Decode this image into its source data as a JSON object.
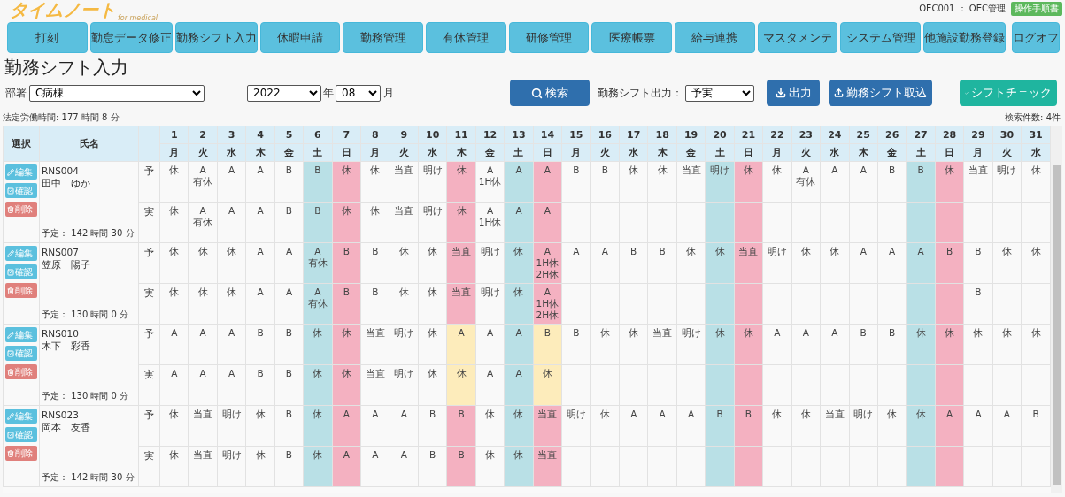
{
  "header": {
    "logo": "タイムノート",
    "logo_sub": "for medical",
    "user": "OEC001 ： OEC管理",
    "manual_button": "操作手順書"
  },
  "nav": [
    {
      "label": "打刻"
    },
    {
      "label": "勤怠データ修正"
    },
    {
      "label": "勤務シフト入力"
    },
    {
      "label": "休暇申請"
    },
    {
      "label": "勤務管理"
    },
    {
      "label": "有休管理"
    },
    {
      "label": "研修管理"
    },
    {
      "label": "医療帳票"
    },
    {
      "label": "給与連携"
    },
    {
      "label": "マスタメンテ"
    },
    {
      "label": "システム管理"
    },
    {
      "label": "他施設勤務登録"
    }
  ],
  "logoff": "ログオフ",
  "page_title": "勤務シフト入力",
  "filters": {
    "department_label": "部署",
    "department": "C病棟",
    "year": "2022",
    "year_unit": "年",
    "month": "08",
    "month_unit": "月",
    "search_button": "検索",
    "output_label": "勤務シフト出力：",
    "output_value": "予実",
    "export_button": "出力",
    "import_button": "勤務シフト取込",
    "check_button": "シフトチェック"
  },
  "legal_hours": "法定労働時間: 177 時間 8 分",
  "result_count": "検索件数: 4件",
  "table": {
    "columns": [
      "選択",
      "氏名"
    ],
    "days": [
      {
        "day": "1",
        "weekday": "月",
        "kind": "weekday"
      },
      {
        "day": "2",
        "weekday": "火",
        "kind": "weekday"
      },
      {
        "day": "3",
        "weekday": "水",
        "kind": "weekday"
      },
      {
        "day": "4",
        "weekday": "木",
        "kind": "weekday"
      },
      {
        "day": "5",
        "weekday": "金",
        "kind": "weekday"
      },
      {
        "day": "6",
        "weekday": "土",
        "kind": "saturday"
      },
      {
        "day": "7",
        "weekday": "日",
        "kind": "holiday"
      },
      {
        "day": "8",
        "weekday": "月",
        "kind": "weekday"
      },
      {
        "day": "9",
        "weekday": "火",
        "kind": "weekday"
      },
      {
        "day": "10",
        "weekday": "水",
        "kind": "weekday"
      },
      {
        "day": "11",
        "weekday": "木",
        "kind": "holiday"
      },
      {
        "day": "12",
        "weekday": "金",
        "kind": "weekday"
      },
      {
        "day": "13",
        "weekday": "土",
        "kind": "saturday"
      },
      {
        "day": "14",
        "weekday": "日",
        "kind": "holiday"
      },
      {
        "day": "15",
        "weekday": "月",
        "kind": "weekday"
      },
      {
        "day": "16",
        "weekday": "火",
        "kind": "weekday"
      },
      {
        "day": "17",
        "weekday": "水",
        "kind": "weekday"
      },
      {
        "day": "18",
        "weekday": "木",
        "kind": "weekday"
      },
      {
        "day": "19",
        "weekday": "金",
        "kind": "weekday"
      },
      {
        "day": "20",
        "weekday": "土",
        "kind": "saturday"
      },
      {
        "day": "21",
        "weekday": "日",
        "kind": "holiday"
      },
      {
        "day": "22",
        "weekday": "月",
        "kind": "weekday"
      },
      {
        "day": "23",
        "weekday": "火",
        "kind": "weekday"
      },
      {
        "day": "24",
        "weekday": "水",
        "kind": "weekday"
      },
      {
        "day": "25",
        "weekday": "木",
        "kind": "weekday"
      },
      {
        "day": "26",
        "weekday": "金",
        "kind": "weekday"
      },
      {
        "day": "27",
        "weekday": "土",
        "kind": "saturday"
      },
      {
        "day": "28",
        "weekday": "日",
        "kind": "holiday"
      },
      {
        "day": "29",
        "weekday": "月",
        "kind": "weekday"
      },
      {
        "day": "30",
        "weekday": "火",
        "kind": "weekday"
      },
      {
        "day": "31",
        "weekday": "水",
        "kind": "weekday"
      }
    ],
    "staff": [
      {
        "id": "RNS004",
        "name": "田中　ゆか",
        "planned_hours": "予定： 142 時間 30 分",
        "edit_button": "編集",
        "confirm_button": "確認",
        "delete_button": "削除",
        "rows": [
          {
            "type_label": "予",
            "cells": [
              "休",
              "A\n有休",
              "A",
              "A",
              "B",
              "B",
              "休",
              "休",
              "当直",
              "明け",
              "休",
              "A\n1H休",
              "A",
              "A",
              "B",
              "B",
              "休",
              "休",
              "当直",
              "明け",
              "休",
              "休",
              "A\n有休",
              "A",
              "A",
              "B",
              "B",
              "休",
              "当直",
              "明け",
              "休"
            ],
            "marked": [
              false,
              false,
              false,
              false,
              false,
              false,
              false,
              false,
              false,
              false,
              false,
              false,
              false,
              false,
              false,
              false,
              false,
              false,
              false,
              false,
              false,
              false,
              false,
              false,
              false,
              false,
              false,
              false,
              false,
              false,
              false
            ]
          },
          {
            "type_label": "実",
            "cells": [
              "休",
              "A\n有休",
              "A",
              "A",
              "B",
              "B",
              "休",
              "休",
              "当直",
              "明け",
              "休",
              "A\n1H休",
              "A",
              "A",
              "",
              "",
              "",
              "",
              "",
              "",
              "",
              "",
              "",
              "",
              "",
              "",
              "",
              "",
              "",
              "",
              ""
            ],
            "marked": [
              false,
              false,
              false,
              false,
              false,
              false,
              false,
              false,
              false,
              false,
              false,
              false,
              false,
              false,
              false,
              false,
              false,
              false,
              false,
              false,
              false,
              false,
              false,
              false,
              false,
              false,
              false,
              false,
              false,
              false,
              false
            ]
          }
        ]
      },
      {
        "id": "RNS007",
        "name": "笠原　陽子",
        "planned_hours": "予定： 130 時間 0 分",
        "edit_button": "編集",
        "confirm_button": "確認",
        "delete_button": "削除",
        "rows": [
          {
            "type_label": "予",
            "cells": [
              "休",
              "休",
              "休",
              "A",
              "A",
              "A\n有休",
              "B",
              "B",
              "休",
              "休",
              "当直",
              "明け",
              "休",
              "A\n1H休\n2H休",
              "A",
              "A",
              "B",
              "B",
              "休",
              "休",
              "当直",
              "明け",
              "休",
              "休",
              "A",
              "A",
              "A",
              "B",
              "B",
              "休",
              "休"
            ],
            "marked": [
              false,
              false,
              false,
              false,
              false,
              false,
              false,
              false,
              false,
              false,
              false,
              false,
              false,
              false,
              false,
              false,
              false,
              false,
              false,
              false,
              false,
              false,
              false,
              false,
              false,
              false,
              false,
              false,
              false,
              false,
              false
            ]
          },
          {
            "type_label": "実",
            "cells": [
              "休",
              "休",
              "休",
              "A",
              "A",
              "A\n有休",
              "B",
              "B",
              "休",
              "休",
              "当直",
              "明け",
              "休",
              "A\n1H休\n2H休",
              "",
              "",
              "",
              "",
              "",
              "",
              "",
              "",
              "",
              "",
              "",
              "",
              "",
              "",
              "B",
              "",
              ""
            ],
            "marked": [
              false,
              false,
              false,
              false,
              false,
              false,
              false,
              false,
              false,
              false,
              false,
              false,
              false,
              false,
              false,
              false,
              false,
              false,
              false,
              false,
              false,
              false,
              false,
              false,
              false,
              false,
              false,
              false,
              false,
              false,
              false
            ]
          }
        ]
      },
      {
        "id": "RNS010",
        "name": "木下　彩香",
        "planned_hours": "予定： 130 時間 0 分",
        "edit_button": "編集",
        "confirm_button": "確認",
        "delete_button": "削除",
        "rows": [
          {
            "type_label": "予",
            "cells": [
              "A",
              "A",
              "A",
              "B",
              "B",
              "休",
              "休",
              "当直",
              "明け",
              "休",
              "A",
              "A",
              "A",
              "B",
              "B",
              "休",
              "休",
              "当直",
              "明け",
              "休",
              "休",
              "A",
              "A",
              "A",
              "B",
              "B",
              "休",
              "休",
              "休",
              "休",
              "休"
            ],
            "marked": [
              false,
              false,
              false,
              false,
              false,
              false,
              false,
              false,
              false,
              false,
              true,
              false,
              false,
              true,
              false,
              false,
              false,
              false,
              false,
              false,
              false,
              false,
              false,
              false,
              false,
              false,
              false,
              false,
              false,
              false,
              false
            ]
          },
          {
            "type_label": "実",
            "cells": [
              "A",
              "A",
              "A",
              "B",
              "B",
              "休",
              "休",
              "当直",
              "明け",
              "休",
              "休",
              "A",
              "A",
              "休",
              "",
              "",
              "",
              "",
              "",
              "",
              "",
              "",
              "",
              "",
              "",
              "",
              "",
              "",
              "",
              "",
              ""
            ],
            "marked": [
              false,
              false,
              false,
              false,
              false,
              false,
              false,
              false,
              false,
              false,
              true,
              false,
              false,
              true,
              false,
              false,
              false,
              false,
              false,
              false,
              false,
              false,
              false,
              false,
              false,
              false,
              false,
              false,
              false,
              false,
              false
            ]
          }
        ]
      },
      {
        "id": "RNS023",
        "name": "岡本　友香",
        "planned_hours": "予定： 142 時間 30 分",
        "edit_button": "編集",
        "confirm_button": "確認",
        "delete_button": "削除",
        "rows": [
          {
            "type_label": "予",
            "cells": [
              "休",
              "当直",
              "明け",
              "休",
              "B",
              "休",
              "A",
              "A",
              "A",
              "B",
              "B",
              "休",
              "休",
              "当直",
              "明け",
              "休",
              "A",
              "A",
              "A",
              "B",
              "B",
              "休",
              "休",
              "当直",
              "明け",
              "休",
              "休",
              "A",
              "A",
              "A",
              "B"
            ],
            "marked": [
              false,
              false,
              false,
              false,
              false,
              false,
              false,
              false,
              false,
              false,
              false,
              false,
              false,
              false,
              false,
              false,
              false,
              false,
              false,
              false,
              false,
              false,
              false,
              false,
              false,
              false,
              false,
              false,
              false,
              false,
              false
            ]
          },
          {
            "type_label": "実",
            "cells": [
              "休",
              "当直",
              "明け",
              "休",
              "B",
              "休",
              "A",
              "A",
              "A",
              "B",
              "B",
              "休",
              "休",
              "当直",
              "",
              "",
              "",
              "",
              "",
              "",
              "",
              "",
              "",
              "",
              "",
              "",
              "",
              "",
              "",
              "",
              ""
            ],
            "marked": [
              false,
              false,
              false,
              false,
              false,
              false,
              false,
              false,
              false,
              false,
              false,
              false,
              false,
              false,
              false,
              false,
              false,
              false,
              false,
              false,
              false,
              false,
              false,
              false,
              false,
              false,
              false,
              false,
              false,
              false,
              false
            ]
          }
        ]
      }
    ]
  }
}
